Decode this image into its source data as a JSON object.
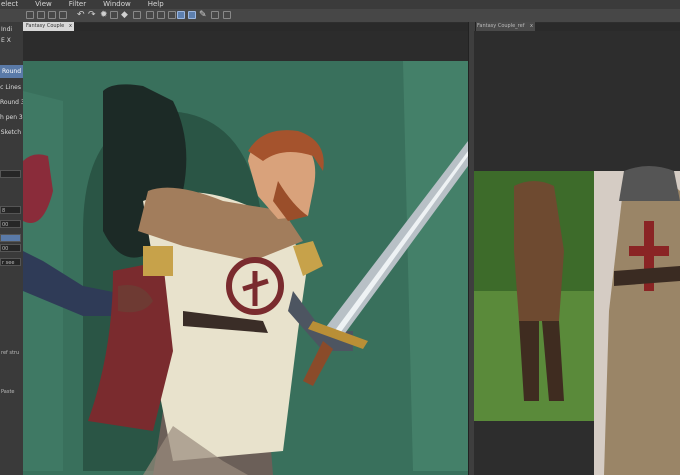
{
  "menu": [
    "elect",
    "View",
    "Filter",
    "Window",
    "Help"
  ],
  "tabs": {
    "canvas": "Fantasy Couple",
    "reference": "Fantasy Couple_ref",
    "close": "x"
  },
  "layers_tool": {
    "label1": "Indi",
    "label2": "E X"
  },
  "brushes": [
    "Round",
    "c Lines",
    "Round 3",
    "h pen 3",
    "Sketch"
  ],
  "left_panel": {
    "values": [
      "8",
      "00",
      "00"
    ],
    "blend": "r see",
    "hint": "ref stru",
    "paste": "Paste"
  },
  "colors": {
    "accent": "#5a7aa8",
    "panel": "#3a3a3a",
    "canvas_bg": "#3f7a64"
  }
}
